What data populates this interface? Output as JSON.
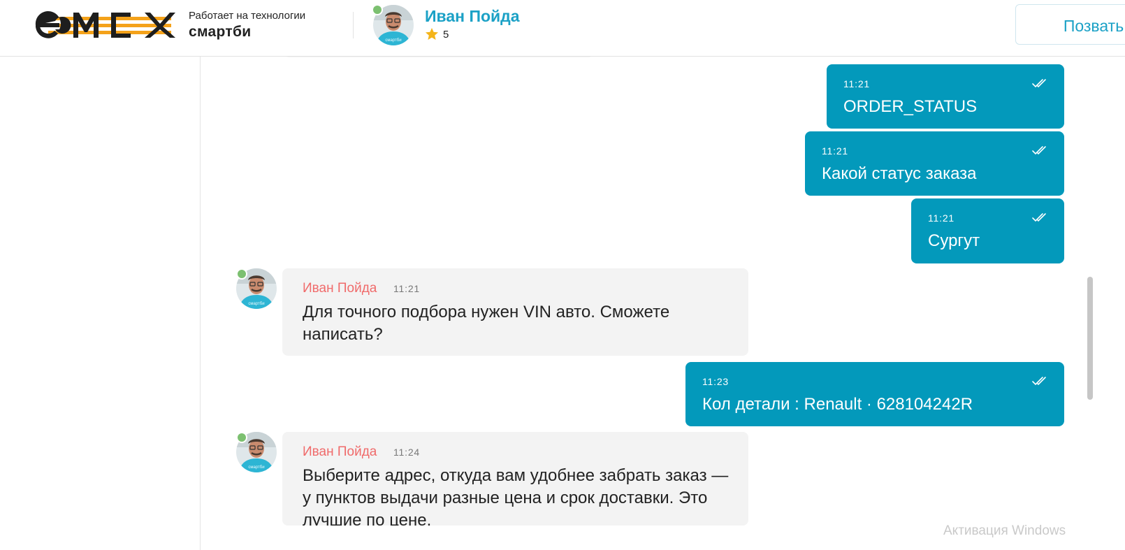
{
  "header": {
    "tech_line": "Работает на технологии",
    "tech_brand": "смартби",
    "operator_name": "Иван Пойда",
    "rating": "5",
    "invite_button": "Позвать"
  },
  "colors": {
    "accent": "#0399bb",
    "name_link": "#1ba1c6",
    "author_name": "#f06b6b",
    "online": "#7cc070",
    "logo_orange": "#f4a21a"
  },
  "icons": [
    "emex-logo",
    "avatar",
    "star-icon",
    "double-check-icon"
  ],
  "messages": [
    {
      "type": "outgoing",
      "time": "11:21",
      "text": "ORDER_STATUS"
    },
    {
      "type": "outgoing",
      "time": "11:21",
      "text": "Какой статус заказа"
    },
    {
      "type": "outgoing",
      "time": "11:21",
      "text": "Сургут"
    },
    {
      "type": "incoming",
      "author": "Иван Пойда",
      "time": "11:21",
      "text": "Для точного подбора нужен VIN авто. Сможете написать?"
    },
    {
      "type": "outgoing",
      "time": "11:23",
      "text": "Кол детали : Renault · 628104242R"
    },
    {
      "type": "incoming",
      "author": "Иван Пойда",
      "time": "11:24",
      "text": "Выберите адрес, откуда вам удобнее забрать заказ — у пунктов выдачи разные цена и срок доставки. Это лучшие по цене."
    }
  ],
  "watermark": "Активация Windows"
}
